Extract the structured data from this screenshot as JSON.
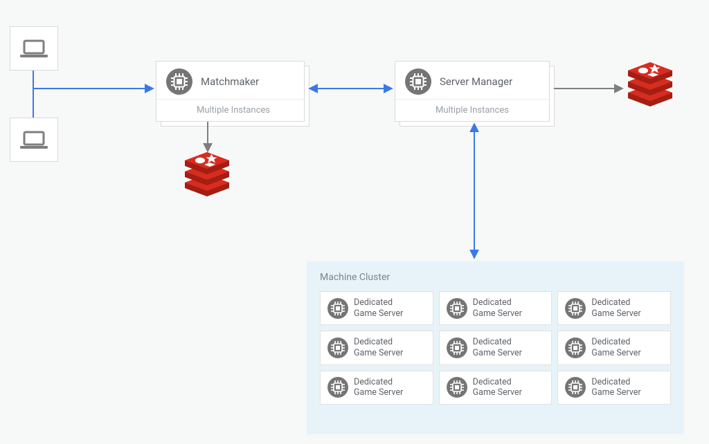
{
  "clients": {},
  "matchmaker": {
    "title": "Matchmaker",
    "subtitle": "Multiple Instances"
  },
  "server_manager": {
    "title": "Server Manager",
    "subtitle": "Multiple Instances"
  },
  "cluster": {
    "title": "Machine Cluster",
    "cell_label": "Dedicated\nGame Server"
  },
  "colors": {
    "arrow_blue": "#3b78e7",
    "arrow_gray": "#7e7e7e",
    "redis_red": "#a41e11",
    "redis_red_light": "#d82c20",
    "icon_gray": "#757575"
  }
}
